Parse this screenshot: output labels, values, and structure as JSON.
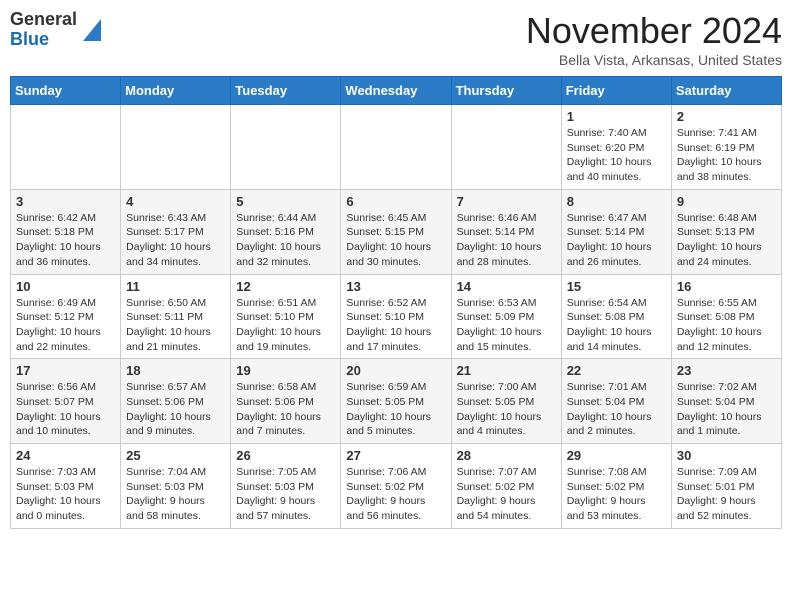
{
  "header": {
    "logo_general": "General",
    "logo_blue": "Blue",
    "month": "November 2024",
    "location": "Bella Vista, Arkansas, United States"
  },
  "days_of_week": [
    "Sunday",
    "Monday",
    "Tuesday",
    "Wednesday",
    "Thursday",
    "Friday",
    "Saturday"
  ],
  "weeks": [
    [
      {
        "day": "",
        "info": ""
      },
      {
        "day": "",
        "info": ""
      },
      {
        "day": "",
        "info": ""
      },
      {
        "day": "",
        "info": ""
      },
      {
        "day": "",
        "info": ""
      },
      {
        "day": "1",
        "info": "Sunrise: 7:40 AM\nSunset: 6:20 PM\nDaylight: 10 hours and 40 minutes."
      },
      {
        "day": "2",
        "info": "Sunrise: 7:41 AM\nSunset: 6:19 PM\nDaylight: 10 hours and 38 minutes."
      }
    ],
    [
      {
        "day": "3",
        "info": "Sunrise: 6:42 AM\nSunset: 5:18 PM\nDaylight: 10 hours and 36 minutes."
      },
      {
        "day": "4",
        "info": "Sunrise: 6:43 AM\nSunset: 5:17 PM\nDaylight: 10 hours and 34 minutes."
      },
      {
        "day": "5",
        "info": "Sunrise: 6:44 AM\nSunset: 5:16 PM\nDaylight: 10 hours and 32 minutes."
      },
      {
        "day": "6",
        "info": "Sunrise: 6:45 AM\nSunset: 5:15 PM\nDaylight: 10 hours and 30 minutes."
      },
      {
        "day": "7",
        "info": "Sunrise: 6:46 AM\nSunset: 5:14 PM\nDaylight: 10 hours and 28 minutes."
      },
      {
        "day": "8",
        "info": "Sunrise: 6:47 AM\nSunset: 5:14 PM\nDaylight: 10 hours and 26 minutes."
      },
      {
        "day": "9",
        "info": "Sunrise: 6:48 AM\nSunset: 5:13 PM\nDaylight: 10 hours and 24 minutes."
      }
    ],
    [
      {
        "day": "10",
        "info": "Sunrise: 6:49 AM\nSunset: 5:12 PM\nDaylight: 10 hours and 22 minutes."
      },
      {
        "day": "11",
        "info": "Sunrise: 6:50 AM\nSunset: 5:11 PM\nDaylight: 10 hours and 21 minutes."
      },
      {
        "day": "12",
        "info": "Sunrise: 6:51 AM\nSunset: 5:10 PM\nDaylight: 10 hours and 19 minutes."
      },
      {
        "day": "13",
        "info": "Sunrise: 6:52 AM\nSunset: 5:10 PM\nDaylight: 10 hours and 17 minutes."
      },
      {
        "day": "14",
        "info": "Sunrise: 6:53 AM\nSunset: 5:09 PM\nDaylight: 10 hours and 15 minutes."
      },
      {
        "day": "15",
        "info": "Sunrise: 6:54 AM\nSunset: 5:08 PM\nDaylight: 10 hours and 14 minutes."
      },
      {
        "day": "16",
        "info": "Sunrise: 6:55 AM\nSunset: 5:08 PM\nDaylight: 10 hours and 12 minutes."
      }
    ],
    [
      {
        "day": "17",
        "info": "Sunrise: 6:56 AM\nSunset: 5:07 PM\nDaylight: 10 hours and 10 minutes."
      },
      {
        "day": "18",
        "info": "Sunrise: 6:57 AM\nSunset: 5:06 PM\nDaylight: 10 hours and 9 minutes."
      },
      {
        "day": "19",
        "info": "Sunrise: 6:58 AM\nSunset: 5:06 PM\nDaylight: 10 hours and 7 minutes."
      },
      {
        "day": "20",
        "info": "Sunrise: 6:59 AM\nSunset: 5:05 PM\nDaylight: 10 hours and 5 minutes."
      },
      {
        "day": "21",
        "info": "Sunrise: 7:00 AM\nSunset: 5:05 PM\nDaylight: 10 hours and 4 minutes."
      },
      {
        "day": "22",
        "info": "Sunrise: 7:01 AM\nSunset: 5:04 PM\nDaylight: 10 hours and 2 minutes."
      },
      {
        "day": "23",
        "info": "Sunrise: 7:02 AM\nSunset: 5:04 PM\nDaylight: 10 hours and 1 minute."
      }
    ],
    [
      {
        "day": "24",
        "info": "Sunrise: 7:03 AM\nSunset: 5:03 PM\nDaylight: 10 hours and 0 minutes."
      },
      {
        "day": "25",
        "info": "Sunrise: 7:04 AM\nSunset: 5:03 PM\nDaylight: 9 hours and 58 minutes."
      },
      {
        "day": "26",
        "info": "Sunrise: 7:05 AM\nSunset: 5:03 PM\nDaylight: 9 hours and 57 minutes."
      },
      {
        "day": "27",
        "info": "Sunrise: 7:06 AM\nSunset: 5:02 PM\nDaylight: 9 hours and 56 minutes."
      },
      {
        "day": "28",
        "info": "Sunrise: 7:07 AM\nSunset: 5:02 PM\nDaylight: 9 hours and 54 minutes."
      },
      {
        "day": "29",
        "info": "Sunrise: 7:08 AM\nSunset: 5:02 PM\nDaylight: 9 hours and 53 minutes."
      },
      {
        "day": "30",
        "info": "Sunrise: 7:09 AM\nSunset: 5:01 PM\nDaylight: 9 hours and 52 minutes."
      }
    ]
  ]
}
